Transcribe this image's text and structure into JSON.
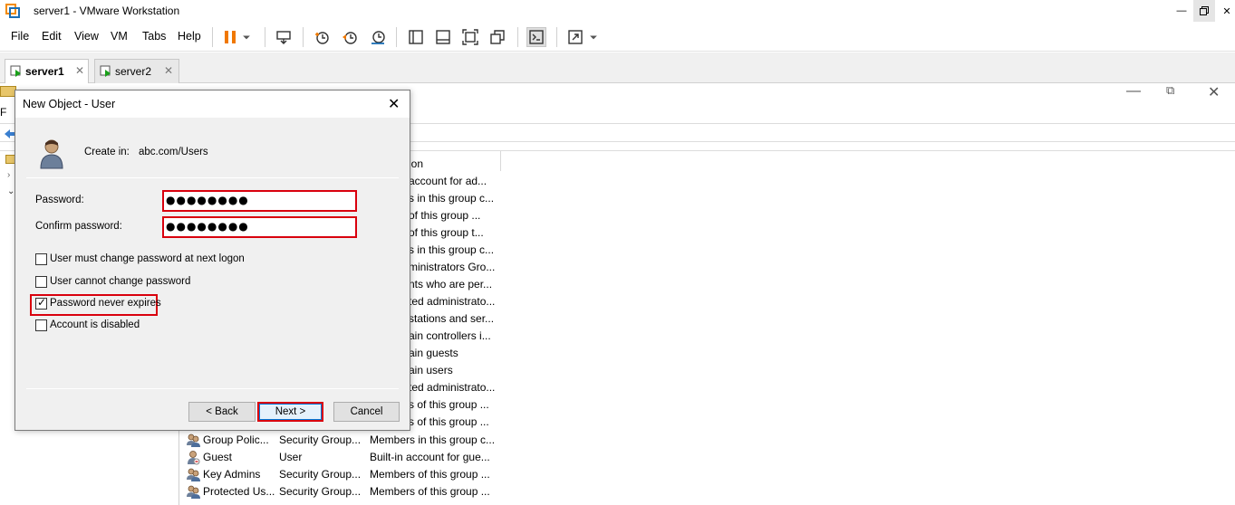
{
  "window": {
    "title": "server1 - VMware Workstation"
  },
  "menu": {
    "items": [
      "File",
      "Edit",
      "View",
      "VM",
      "Tabs",
      "Help"
    ]
  },
  "tabs": [
    {
      "label": "server1",
      "active": true
    },
    {
      "label": "server2",
      "active": false
    }
  ],
  "dialog": {
    "title": "New Object - User",
    "create_in_label": "Create in:",
    "create_in_path": "abc.com/Users",
    "password_label": "Password:",
    "password_value": "●●●●●●●●",
    "confirm_label": "Confirm password:",
    "confirm_value": "●●●●●●●●",
    "checkboxes": [
      {
        "label": "User must change password at next logon",
        "checked": false
      },
      {
        "label": "User cannot change password",
        "checked": false
      },
      {
        "label": "Password never expires",
        "checked": true
      },
      {
        "label": "Account is disabled",
        "checked": false
      }
    ],
    "back_label": "< Back",
    "next_label": "Next >",
    "cancel_label": "Cancel",
    "highlight_color": "#d9000d"
  },
  "background_list": {
    "description_header": "ion",
    "partial_descriptions": [
      "account for ad...",
      "s in this group c...",
      "of this group ...",
      "of this group t...",
      "s in this group c...",
      "ministrators Gro...",
      "nts who are per...",
      "ted administrato...",
      "stations and ser...",
      "ain controllers i...",
      "ain guests",
      "ain users",
      "ted administrato...",
      "s of this group ...",
      "s of this group ..."
    ],
    "rows": [
      {
        "name": "Group Polic...",
        "type": "Security Group...",
        "description": "Members in this group c..."
      },
      {
        "name": "Guest",
        "type": "User",
        "description": "Built-in account for gue..."
      },
      {
        "name": "Key Admins",
        "type": "Security Group...",
        "description": "Members of this group ..."
      },
      {
        "name": "Protected Us...",
        "type": "Security Group...",
        "description": "Members of this group ..."
      }
    ]
  }
}
